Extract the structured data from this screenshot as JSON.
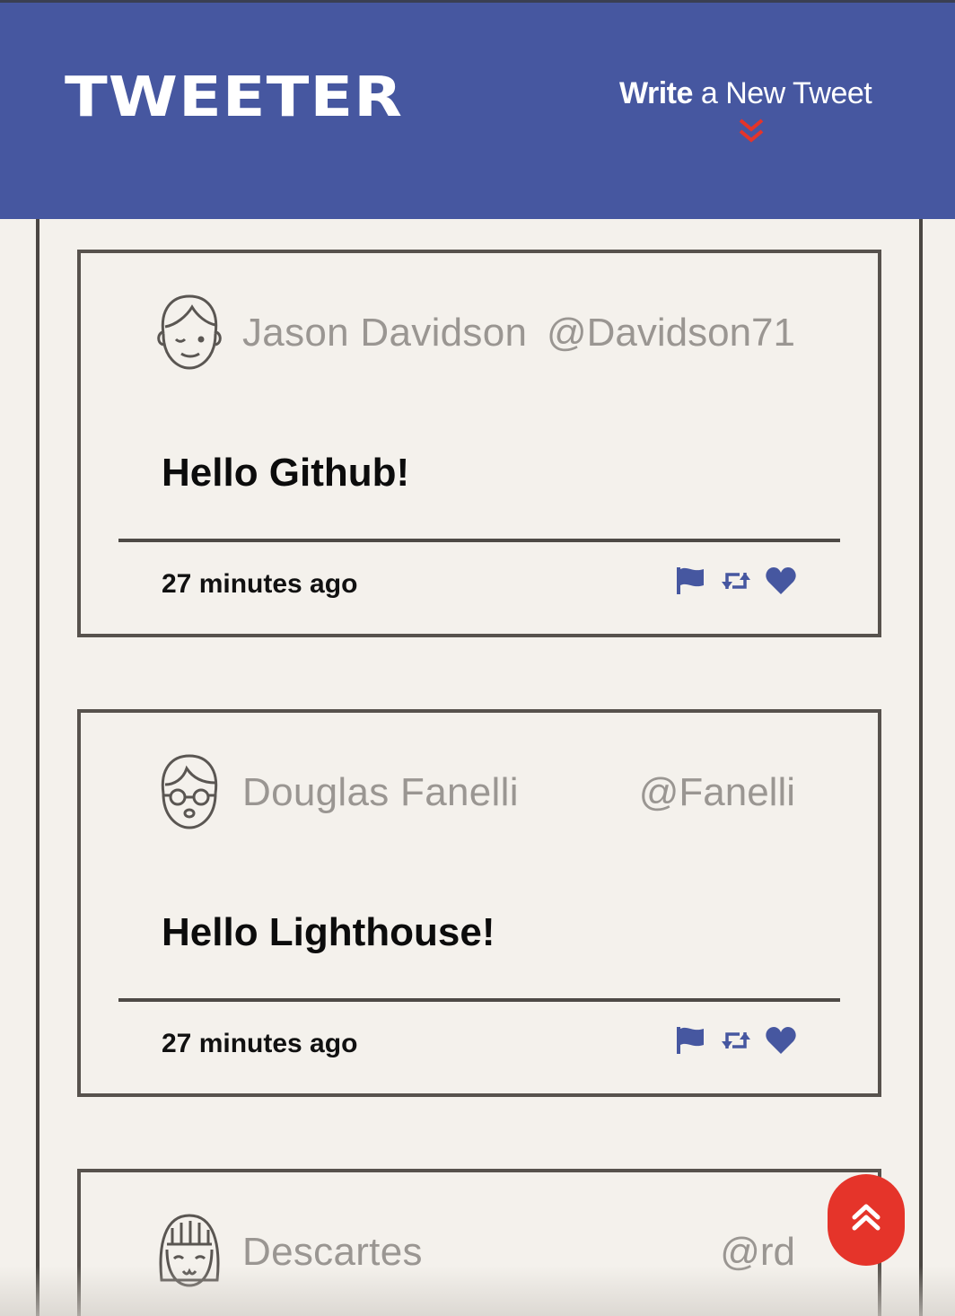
{
  "header": {
    "logo": "TWEETER",
    "compose_bold": "Write",
    "compose_rest": " a New Tweet"
  },
  "colors": {
    "nav_bg": "#4657a0",
    "accent_red": "#e5342a",
    "action_icon": "#4657a0",
    "page_bg": "#f4f1ec"
  },
  "tweets": [
    {
      "name": "Jason Davidson",
      "handle": "@Davidson71",
      "text": "Hello Github!",
      "time": "27 minutes ago",
      "avatar": "smiling-man-avatar"
    },
    {
      "name": "Douglas Fanelli",
      "handle": "@Fanelli",
      "text": "Hello Lighthouse!",
      "time": "27 minutes ago",
      "avatar": "man-with-glasses-avatar"
    },
    {
      "name": "Descartes",
      "handle": "@rd",
      "text": "",
      "time": "",
      "avatar": "girl-with-bangs-avatar"
    }
  ],
  "actions": [
    "flag-icon",
    "retweet-icon",
    "heart-icon"
  ],
  "scroll_top_icon": "double-chevron-up-icon"
}
